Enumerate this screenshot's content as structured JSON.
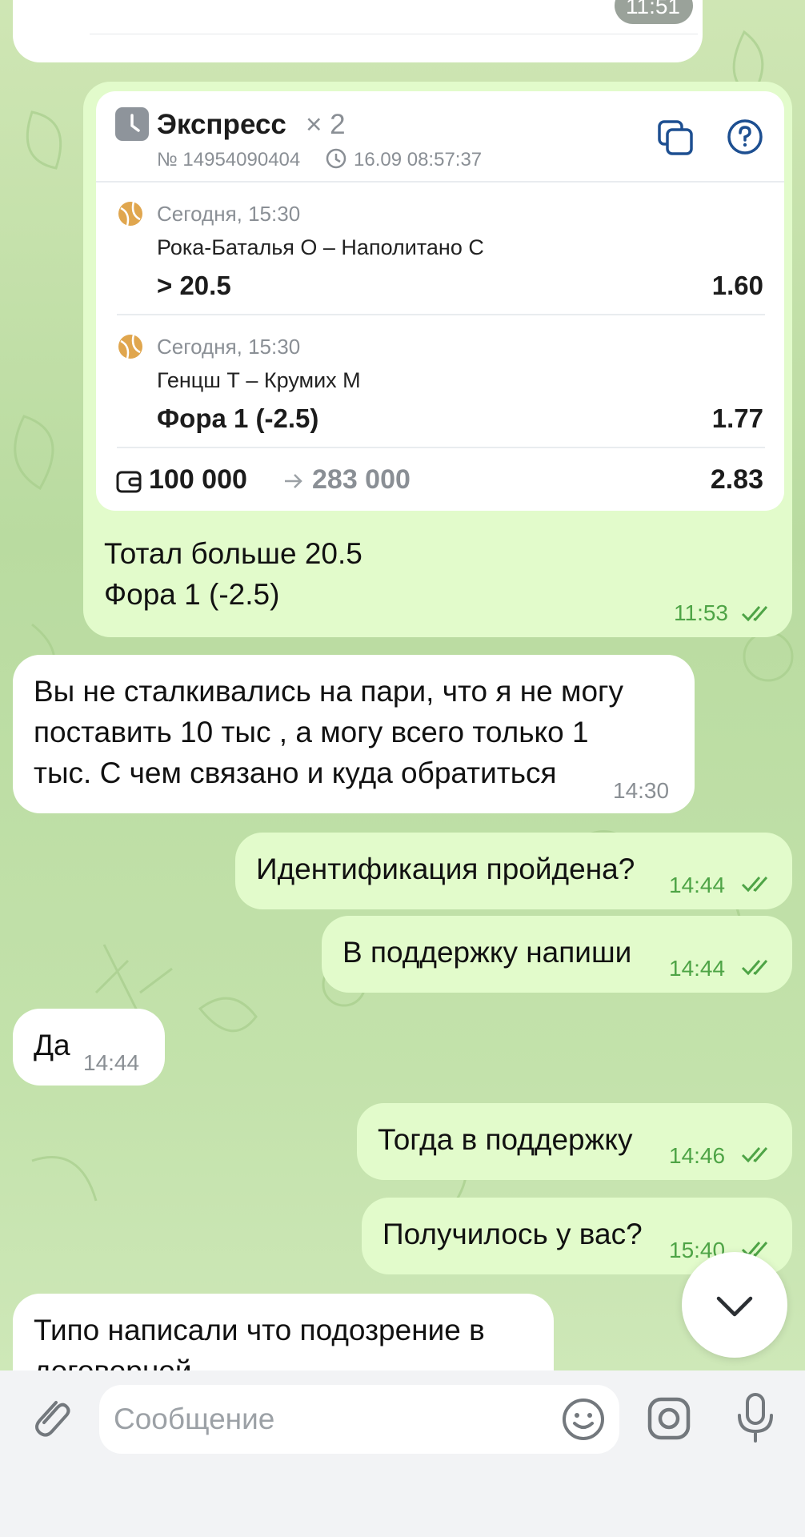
{
  "messages": {
    "m0": {
      "time": "11:51"
    },
    "bet": {
      "title": "Экспресс",
      "multiplier": "× 2",
      "number": "№ 14954090404",
      "datetime": "16.09 08:57:37",
      "events": [
        {
          "when": "Сегодня, 15:30",
          "match": "Рока-Баталья О – Наполитано С",
          "market": "> 20.5",
          "odds": "1.60"
        },
        {
          "when": "Сегодня, 15:30",
          "match": "Генцш Т – Крумих М",
          "market": "Фора 1 (-2.5)",
          "odds": "1.77"
        }
      ],
      "stake": "100 000",
      "payout": "283 000",
      "total_odds": "2.83",
      "caption": "Тотал больше 20.5\nФора 1 (-2.5)",
      "time": "11:53"
    },
    "m2": {
      "text": "Вы не сталкивались на пари, что я не могу\nпоставить 10 тыс , а могу всего только 1\nтыс. С чем связано и куда обратиться",
      "time": "14:30"
    },
    "m3": {
      "text": "Идентификация пройдена?",
      "time": "14:44"
    },
    "m4": {
      "text": "В поддержку напиши",
      "time": "14:44"
    },
    "m5": {
      "text": "Да",
      "time": "14:44"
    },
    "m6": {
      "text": "Тогда в поддержку",
      "time": "14:46"
    },
    "m7": {
      "text": "Получилось у вас?",
      "time": "15:40"
    },
    "m8": {
      "text": "Типо написали что подозрение в\nдоговорной"
    }
  },
  "composer": {
    "placeholder": "Сообщение"
  },
  "icons": [
    "clock-icon",
    "copy-icon",
    "help-icon",
    "tennis-ball-icon",
    "wallet-icon",
    "arrow-right-icon",
    "double-check-icon",
    "chevron-down-icon",
    "paperclip-icon",
    "emoji-icon",
    "camera-icon",
    "microphone-icon"
  ],
  "colors": {
    "outgoing": "#e2fbcb",
    "incoming": "#ffffff",
    "time_out": "#4ea446",
    "accent": "#1d4f91"
  }
}
